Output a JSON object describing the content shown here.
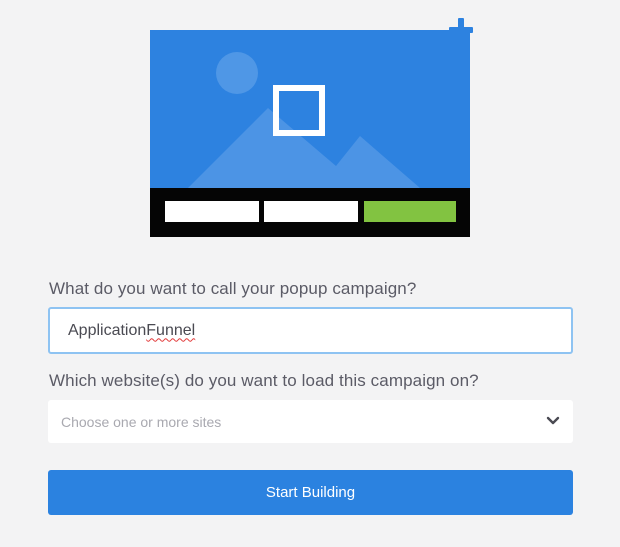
{
  "form": {
    "name_question": "What do you want to call your popup campaign?",
    "name_value_part1": "Application ",
    "name_value_part2": "Funnel",
    "sites_question": "Which website(s) do you want to load this campaign on?",
    "sites_placeholder": "Choose one or more sites",
    "start_label": "Start Building"
  },
  "icons": {
    "illustration": "popup-template-illustration-icon",
    "add": "plus-icon",
    "select": "chevron-down-icon"
  },
  "colors": {
    "accent": "#2b82e0",
    "illustration_blue": "#2d82e0",
    "illustration_green": "#82c341",
    "field_focus_border": "#8ec3f2"
  }
}
